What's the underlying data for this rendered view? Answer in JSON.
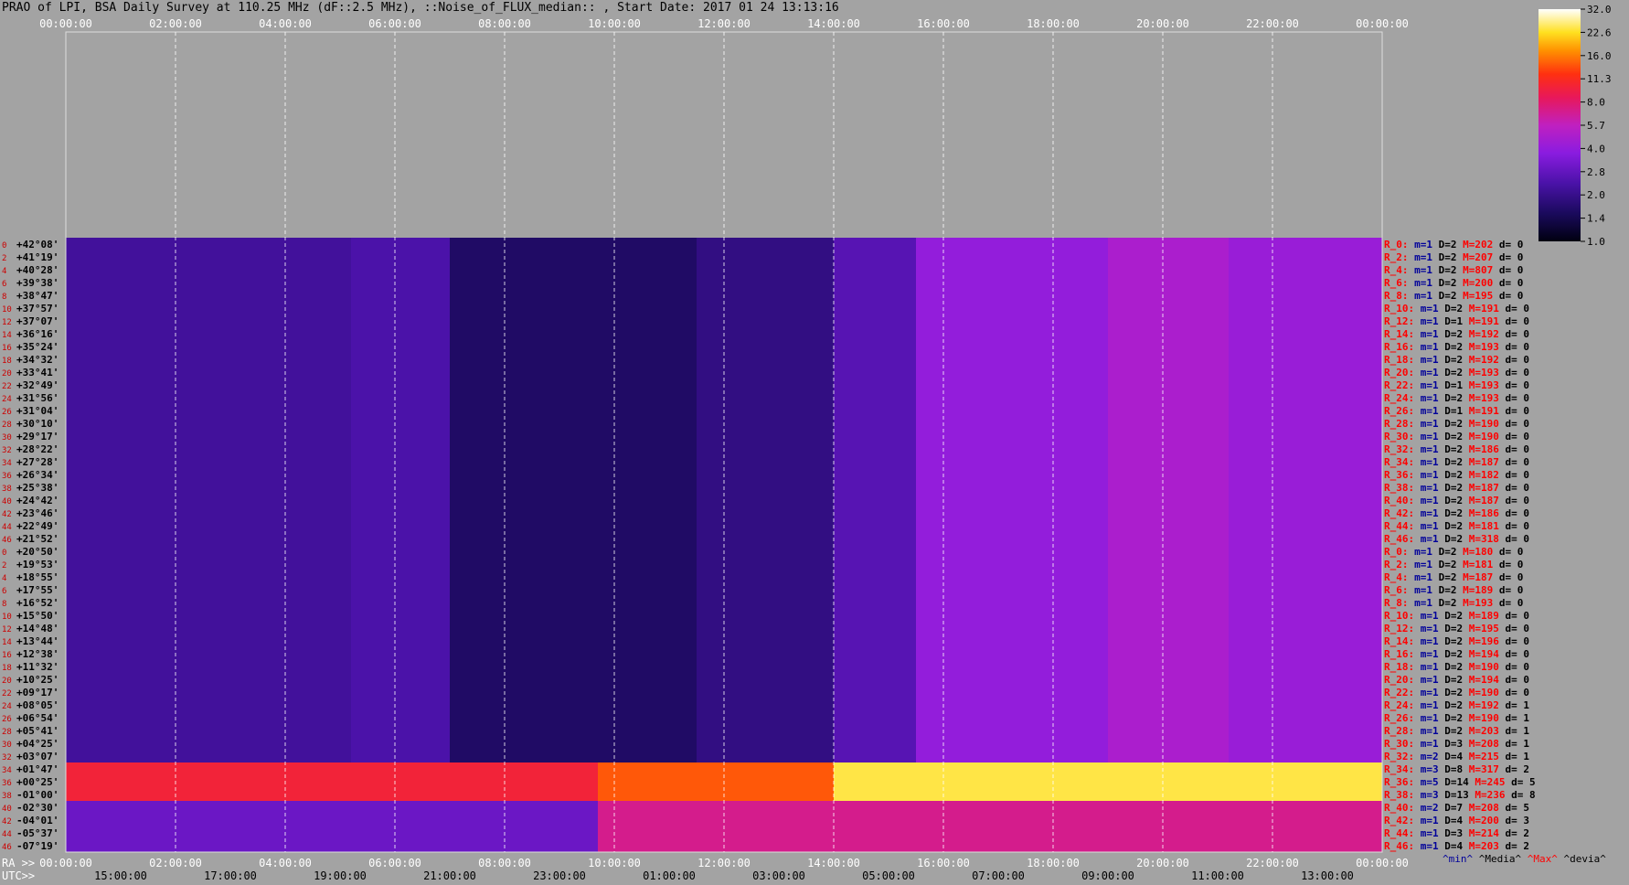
{
  "title": "PRAO of LPI, BSA Daily Survey at 110.25 MHz (dF::2.5 MHz), ::Noise_of_FLUX_median:: , Start Date: 2017 01 24 13:13:16",
  "chart_data": {
    "type": "heatmap",
    "x_axis_top": {
      "ticks": [
        "00:00:00",
        "02:00:00",
        "04:00:00",
        "06:00:00",
        "08:00:00",
        "10:00:00",
        "12:00:00",
        "14:00:00",
        "16:00:00",
        "18:00:00",
        "20:00:00",
        "22:00:00",
        "00:00:00"
      ]
    },
    "x_axis_ra": {
      "label": "RA >>",
      "ticks": [
        "00:00:00",
        "02:00:00",
        "04:00:00",
        "06:00:00",
        "08:00:00",
        "10:00:00",
        "12:00:00",
        "14:00:00",
        "16:00:00",
        "18:00:00",
        "20:00:00",
        "22:00:00",
        "00:00:00"
      ]
    },
    "x_axis_utc": {
      "label": "UTC>>",
      "ticks": [
        "15:00:00",
        "17:00:00",
        "19:00:00",
        "21:00:00",
        "23:00:00",
        "01:00:00",
        "03:00:00",
        "05:00:00",
        "07:00:00",
        "09:00:00",
        "11:00:00",
        "13:00:00"
      ]
    },
    "row_numbers": [
      "0",
      "2",
      "4",
      "6",
      "8",
      "10",
      "12",
      "14",
      "16",
      "18",
      "20",
      "22",
      "24",
      "26",
      "28",
      "30",
      "32",
      "34",
      "36",
      "38",
      "40",
      "42",
      "44",
      "46",
      "0",
      "2",
      "4",
      "6",
      "8",
      "10",
      "12",
      "14",
      "16",
      "18",
      "20",
      "22",
      "24",
      "26",
      "28",
      "30",
      "32",
      "34",
      "36",
      "38",
      "40",
      "42",
      "44",
      "46"
    ],
    "declinations": [
      "+42°08'",
      "+41°19'",
      "+40°28'",
      "+39°38'",
      "+38°47'",
      "+37°57'",
      "+37°07'",
      "+36°16'",
      "+35°24'",
      "+34°32'",
      "+33°41'",
      "+32°49'",
      "+31°56'",
      "+31°04'",
      "+30°10'",
      "+29°17'",
      "+28°22'",
      "+27°28'",
      "+26°34'",
      "+25°38'",
      "+24°42'",
      "+23°46'",
      "+22°49'",
      "+21°52'",
      "+20°50'",
      "+19°53'",
      "+18°55'",
      "+17°55'",
      "+16°52'",
      "+15°50'",
      "+14°48'",
      "+13°44'",
      "+12°38'",
      "+11°32'",
      "+10°25'",
      "+09°17'",
      "+08°05'",
      "+06°54'",
      "+05°41'",
      "+04°25'",
      "+03°07'",
      "+01°47'",
      "+00°25'",
      "-01°00'",
      "-02°30'",
      "-04°01'",
      "-05°37'",
      "-07°19'"
    ],
    "row_stats": [
      {
        "r": "R_0:",
        "min": "m=1",
        "D": "D=2",
        "M": "M=202",
        "d": "d= 0"
      },
      {
        "r": "R_2:",
        "min": "m=1",
        "D": "D=2",
        "M": "M=207",
        "d": "d= 0"
      },
      {
        "r": "R_4:",
        "min": "m=1",
        "D": "D=2",
        "M": "M=807",
        "d": "d= 0"
      },
      {
        "r": "R_6:",
        "min": "m=1",
        "D": "D=2",
        "M": "M=200",
        "d": "d= 0"
      },
      {
        "r": "R_8:",
        "min": "m=1",
        "D": "D=2",
        "M": "M=195",
        "d": "d= 0"
      },
      {
        "r": "R_10:",
        "min": "m=1",
        "D": "D=2",
        "M": "M=191",
        "d": "d= 0"
      },
      {
        "r": "R_12:",
        "min": "m=1",
        "D": "D=1",
        "M": "M=191",
        "d": "d= 0"
      },
      {
        "r": "R_14:",
        "min": "m=1",
        "D": "D=2",
        "M": "M=192",
        "d": "d= 0"
      },
      {
        "r": "R_16:",
        "min": "m=1",
        "D": "D=2",
        "M": "M=193",
        "d": "d= 0"
      },
      {
        "r": "R_18:",
        "min": "m=1",
        "D": "D=2",
        "M": "M=192",
        "d": "d= 0"
      },
      {
        "r": "R_20:",
        "min": "m=1",
        "D": "D=2",
        "M": "M=193",
        "d": "d= 0"
      },
      {
        "r": "R_22:",
        "min": "m=1",
        "D": "D=1",
        "M": "M=193",
        "d": "d= 0"
      },
      {
        "r": "R_24:",
        "min": "m=1",
        "D": "D=2",
        "M": "M=193",
        "d": "d= 0"
      },
      {
        "r": "R_26:",
        "min": "m=1",
        "D": "D=1",
        "M": "M=191",
        "d": "d= 0"
      },
      {
        "r": "R_28:",
        "min": "m=1",
        "D": "D=2",
        "M": "M=190",
        "d": "d= 0"
      },
      {
        "r": "R_30:",
        "min": "m=1",
        "D": "D=2",
        "M": "M=190",
        "d": "d= 0"
      },
      {
        "r": "R_32:",
        "min": "m=1",
        "D": "D=2",
        "M": "M=186",
        "d": "d= 0"
      },
      {
        "r": "R_34:",
        "min": "m=1",
        "D": "D=2",
        "M": "M=187",
        "d": "d= 0"
      },
      {
        "r": "R_36:",
        "min": "m=1",
        "D": "D=2",
        "M": "M=182",
        "d": "d= 0"
      },
      {
        "r": "R_38:",
        "min": "m=1",
        "D": "D=2",
        "M": "M=187",
        "d": "d= 0"
      },
      {
        "r": "R_40:",
        "min": "m=1",
        "D": "D=2",
        "M": "M=187",
        "d": "d= 0"
      },
      {
        "r": "R_42:",
        "min": "m=1",
        "D": "D=2",
        "M": "M=186",
        "d": "d= 0"
      },
      {
        "r": "R_44:",
        "min": "m=1",
        "D": "D=2",
        "M": "M=181",
        "d": "d= 0"
      },
      {
        "r": "R_46:",
        "min": "m=1",
        "D": "D=2",
        "M": "M=318",
        "d": "d= 0"
      },
      {
        "r": "R_0:",
        "min": "m=1",
        "D": "D=2",
        "M": "M=180",
        "d": "d= 0"
      },
      {
        "r": "R_2:",
        "min": "m=1",
        "D": "D=2",
        "M": "M=181",
        "d": "d= 0"
      },
      {
        "r": "R_4:",
        "min": "m=1",
        "D": "D=2",
        "M": "M=187",
        "d": "d= 0"
      },
      {
        "r": "R_6:",
        "min": "m=1",
        "D": "D=2",
        "M": "M=189",
        "d": "d= 0"
      },
      {
        "r": "R_8:",
        "min": "m=1",
        "D": "D=2",
        "M": "M=193",
        "d": "d= 0"
      },
      {
        "r": "R_10:",
        "min": "m=1",
        "D": "D=2",
        "M": "M=189",
        "d": "d= 0"
      },
      {
        "r": "R_12:",
        "min": "m=1",
        "D": "D=2",
        "M": "M=195",
        "d": "d= 0"
      },
      {
        "r": "R_14:",
        "min": "m=1",
        "D": "D=2",
        "M": "M=196",
        "d": "d= 0"
      },
      {
        "r": "R_16:",
        "min": "m=1",
        "D": "D=2",
        "M": "M=194",
        "d": "d= 0"
      },
      {
        "r": "R_18:",
        "min": "m=1",
        "D": "D=2",
        "M": "M=190",
        "d": "d= 0"
      },
      {
        "r": "R_20:",
        "min": "m=1",
        "D": "D=2",
        "M": "M=194",
        "d": "d= 0"
      },
      {
        "r": "R_22:",
        "min": "m=1",
        "D": "D=2",
        "M": "M=190",
        "d": "d= 0"
      },
      {
        "r": "R_24:",
        "min": "m=1",
        "D": "D=2",
        "M": "M=192",
        "d": "d= 1"
      },
      {
        "r": "R_26:",
        "min": "m=1",
        "D": "D=2",
        "M": "M=190",
        "d": "d= 1"
      },
      {
        "r": "R_28:",
        "min": "m=1",
        "D": "D=2",
        "M": "M=203",
        "d": "d= 1"
      },
      {
        "r": "R_30:",
        "min": "m=1",
        "D": "D=3",
        "M": "M=208",
        "d": "d= 1"
      },
      {
        "r": "R_32:",
        "min": "m=2",
        "D": "D=4",
        "M": "M=215",
        "d": "d= 1"
      },
      {
        "r": "R_34:",
        "min": "m=3",
        "D": "D=8",
        "M": "M=317",
        "d": "d= 2"
      },
      {
        "r": "R_36:",
        "min": "m=5",
        "D": "D=14",
        "M": "M=245",
        "d": "d= 5"
      },
      {
        "r": "R_38:",
        "min": "m=3",
        "D": "D=13",
        "M": "M=236",
        "d": "d= 8"
      },
      {
        "r": "R_40:",
        "min": "m=2",
        "D": "D=7",
        "M": "M=208",
        "d": "d= 5"
      },
      {
        "r": "R_42:",
        "min": "m=1",
        "D": "D=4",
        "M": "M=200",
        "d": "d= 3"
      },
      {
        "r": "R_44:",
        "min": "m=1",
        "D": "D=3",
        "M": "M=214",
        "d": "d= 2"
      },
      {
        "r": "R_46:",
        "min": "m=1",
        "D": "D=4",
        "M": "M=203",
        "d": "d= 2"
      }
    ],
    "stats_legend": {
      "min": "^min^",
      "media": "^Media^",
      "max": "^Max^",
      "devia": "^devia^"
    },
    "colorbar": {
      "ticks": [
        "32.0",
        "22.6",
        "16.0",
        "11.3",
        "8.0",
        "5.7",
        "4.0",
        "2.8",
        "2.0",
        "1.4",
        "1.0"
      ],
      "scale": "log",
      "range": [
        1.0,
        32.0
      ]
    },
    "colors": {
      "min": "#00009a",
      "media": "#000000",
      "max": "#ff0000",
      "devia": "#000000",
      "row_num": "#cc0000",
      "grid": "#ffffff"
    },
    "regions": [
      {
        "ra_start": 0.0,
        "ra_end": 5.2,
        "dec_index_from": 0,
        "dec_index_to": 40,
        "level": 2.2
      },
      {
        "ra_start": 5.2,
        "ra_end": 7.0,
        "dec_index_from": 0,
        "dec_index_to": 40,
        "level": 2.4
      },
      {
        "ra_start": 7.0,
        "ra_end": 11.5,
        "dec_index_from": 0,
        "dec_index_to": 40,
        "level": 1.6
      },
      {
        "ra_start": 11.5,
        "ra_end": 14.0,
        "dec_index_from": 0,
        "dec_index_to": 40,
        "level": 1.9
      },
      {
        "ra_start": 14.0,
        "ra_end": 15.5,
        "dec_index_from": 0,
        "dec_index_to": 40,
        "level": 2.6
      },
      {
        "ra_start": 15.5,
        "ra_end": 19.0,
        "dec_index_from": 0,
        "dec_index_to": 40,
        "level": 4.0
      },
      {
        "ra_start": 19.0,
        "ra_end": 21.2,
        "dec_index_from": 0,
        "dec_index_to": 40,
        "level": 4.8
      },
      {
        "ra_start": 21.2,
        "ra_end": 24.0,
        "dec_index_from": 0,
        "dec_index_to": 40,
        "level": 4.2
      },
      {
        "ra_start": 0.0,
        "ra_end": 9.7,
        "dec_index_from": 41,
        "dec_index_to": 43,
        "level": 10.0
      },
      {
        "ra_start": 9.7,
        "ra_end": 14.0,
        "dec_index_from": 41,
        "dec_index_to": 43,
        "level": 14.0
      },
      {
        "ra_start": 14.0,
        "ra_end": 24.0,
        "dec_index_from": 41,
        "dec_index_to": 44,
        "level": 24.0
      },
      {
        "ra_start": 0.0,
        "ra_end": 9.7,
        "dec_index_from": 44,
        "dec_index_to": 47,
        "level": 3.0
      },
      {
        "ra_start": 9.7,
        "ra_end": 24.0,
        "dec_index_from": 44,
        "dec_index_to": 47,
        "level": 7.0
      }
    ]
  }
}
